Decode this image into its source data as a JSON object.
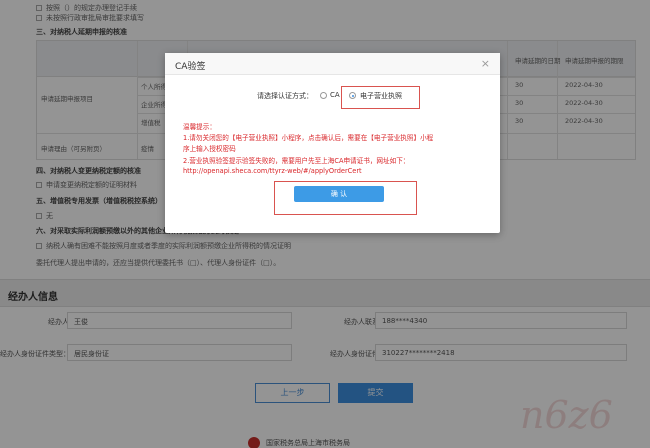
{
  "form": {
    "line0": "按照（）的规定办理登记手续",
    "line1": "未按照行政审批局审批要求填写",
    "section3_title": "三、对纳税人延期申报的核准",
    "table": {
      "header_right1": "申请延期的日期",
      "header_right2": "申请延期申报的期限",
      "row_label": "申请延期申报项目",
      "rows": [
        {
          "name": "个人所得税",
          "date1": "30",
          "date2": "2022-04-30"
        },
        {
          "name": "企业所得税",
          "date1": "30",
          "date2": "2022-04-30"
        },
        {
          "name": "增值税",
          "date1": "30",
          "date2": "2022-04-30"
        }
      ],
      "reason_label": "申请理由（可另附页）",
      "reason_value": "疫情"
    },
    "section4_title": "四、对纳税人变更纳税定额的核准",
    "section4_cb": "申请变更纳税定额的证明材料",
    "section5_title": "五、增值税专用发票（增值税税控系统）",
    "section5_cb": "无",
    "section6_title": "六、对采取实际利润额预缴以外的其他企业所得税预缴方式的核定",
    "section6_cb": "纳税人确有困难不能按照月度或者季度的实际利润额预缴企业所得税的情况证明",
    "agent_line": "委托代理人提出申请的，还应当提供代理委托书（□）、代理人身份证件（□）。"
  },
  "agent_section": {
    "title": "经办人信息",
    "name_label": "经办人姓名：",
    "name_value": "王俊",
    "phone_label": "经办人联系电话：",
    "phone_value": "188****4340",
    "id_type_label": "经办人身份证件类型：",
    "id_type_value": "居民身份证",
    "id_no_label": "经办人身份证件号码：",
    "id_no_value": "310227********2418"
  },
  "buttons": {
    "prev": "上一步",
    "submit": "提交"
  },
  "footer": {
    "text": "国家税务总局上海市税务局"
  },
  "watermark": "n6z6",
  "dialog": {
    "title": "CA验签",
    "close": "×",
    "choose_label": "请选择认证方式：",
    "option_ca": "CA",
    "option_license": "电子营业执照",
    "warn_title": "温馨提示：",
    "warn_lines": [
      "1.请勿关闭您的【电子营业执照】小程序，点击确认后，需要在【电子营业执照】小程",
      "序上输入授权密码",
      "2.营业执照验签提示验签失败的，需要用户先至上海CA申请证书，网址如下：",
      "http://openapi.sheca.com/ttyrz-web/#/applyOrderCert"
    ],
    "confirm": "确 认"
  }
}
